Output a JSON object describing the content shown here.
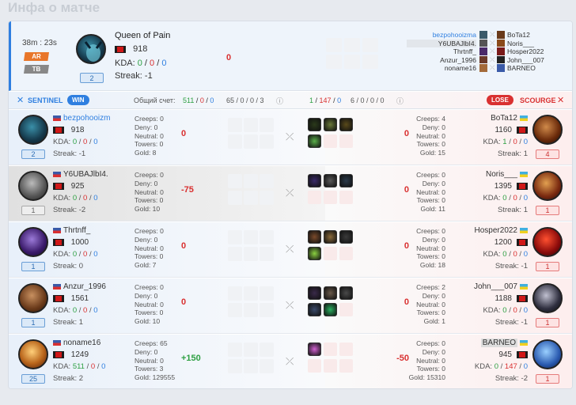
{
  "page_title": "Инфа о матче",
  "summary": {
    "duration": "38m : 23s",
    "mode1": "AR",
    "mode2": "TB",
    "hero_name": "Queen of Pain",
    "hero_level": "2",
    "rating": "918",
    "kda_label": "KDA:",
    "kills": "0",
    "deaths": "0",
    "assists": "0",
    "streak": "Streak: -1",
    "rating_delta": "0",
    "sentinel_players": [
      "bezpohooizma",
      "Y6UBAJlbI4.",
      "Thrtnff_",
      "Anzur_1996",
      "noname16"
    ],
    "scourge_players": [
      "BoTa12",
      "Noris___",
      "Hosper2022",
      "John___007",
      "BARNEO"
    ]
  },
  "teambar": {
    "sentinel": "SENTINEL",
    "win": "WIN",
    "total_label": "Общий счет:",
    "s_k": "511",
    "s_d": "0",
    "s_a": "0",
    "s_extra": "65 / 0 / 0 / 3",
    "c_k": "1",
    "c_d": "147",
    "c_a": "0",
    "c_extra": "6 / 0 / 0 / 0",
    "lose": "LOSE",
    "scourge": "SCOURGE"
  },
  "rows": [
    {
      "name": "bezpohooizm",
      "rating": "918",
      "k": "0",
      "d": "0",
      "a": "0",
      "streak": "Streak: -1",
      "level": "2",
      "creeps": "Creeps: 0",
      "deny": "Deny: 0",
      "neutral": "Neutral: 0",
      "towers": "Towers: 0",
      "gold": "Gold: 8",
      "delta": "0",
      "r_creeps": "Creeps: 4",
      "r_deny": "Deny: 0",
      "r_neutral": "Neutral: 0",
      "r_towers": "Towers: 0",
      "r_gold": "Gold: 15",
      "r_delta": "0",
      "r_name": "BoTa12",
      "r_rating": "1160",
      "r_k": "1",
      "r_d": "0",
      "r_a": "0",
      "r_streak": "Streak: 1",
      "r_level": "4"
    },
    {
      "name": "Y6UBAJlbI4.",
      "rating": "925",
      "k": "0",
      "d": "0",
      "a": "0",
      "streak": "Streak: -2",
      "level": "1",
      "creeps": "Creeps: 0",
      "deny": "Deny: 0",
      "neutral": "Neutral: 0",
      "towers": "Towers: 0",
      "gold": "Gold: 10",
      "delta": "-75",
      "r_creeps": "Creeps: 0",
      "r_deny": "Deny: 0",
      "r_neutral": "Neutral: 0",
      "r_towers": "Towers: 0",
      "r_gold": "Gold: 11",
      "r_delta": "0",
      "r_name": "Noris___",
      "r_rating": "1395",
      "r_k": "0",
      "r_d": "0",
      "r_a": "0",
      "r_streak": "Streak: 1",
      "r_level": "1"
    },
    {
      "name": "Thrtnff_",
      "rating": "1000",
      "k": "0",
      "d": "0",
      "a": "0",
      "streak": "Streak: 0",
      "level": "1",
      "creeps": "Creeps: 0",
      "deny": "Deny: 0",
      "neutral": "Neutral: 0",
      "towers": "Towers: 0",
      "gold": "Gold: 7",
      "delta": "0",
      "r_creeps": "Creeps: 0",
      "r_deny": "Deny: 0",
      "r_neutral": "Neutral: 0",
      "r_towers": "Towers: 0",
      "r_gold": "Gold: 18",
      "r_delta": "0",
      "r_name": "Hosper2022",
      "r_rating": "1200",
      "r_k": "0",
      "r_d": "0",
      "r_a": "0",
      "r_streak": "Streak: -1",
      "r_level": "1"
    },
    {
      "name": "Anzur_1996",
      "rating": "1561",
      "k": "0",
      "d": "0",
      "a": "0",
      "streak": "Streak: 1",
      "level": "1",
      "creeps": "Creeps: 0",
      "deny": "Deny: 0",
      "neutral": "Neutral: 0",
      "towers": "Towers: 0",
      "gold": "Gold: 10",
      "delta": "0",
      "r_creeps": "Creeps: 2",
      "r_deny": "Deny: 0",
      "r_neutral": "Neutral: 0",
      "r_towers": "Towers: 0",
      "r_gold": "Gold: 1",
      "r_delta": "0",
      "r_name": "John___007",
      "r_rating": "1188",
      "r_k": "0",
      "r_d": "0",
      "r_a": "0",
      "r_streak": "Streak: -1",
      "r_level": "1"
    },
    {
      "name": "noname16",
      "rating": "1249",
      "k": "511",
      "d": "0",
      "a": "0",
      "streak": "Streak: 2",
      "level": "25",
      "creeps": "Creeps: 65",
      "deny": "Deny: 0",
      "neutral": "Neutral: 0",
      "towers": "Towers: 3",
      "gold": "Gold: 129555",
      "delta": "+150",
      "r_creeps": "Creeps: 0",
      "r_deny": "Deny: 0",
      "r_neutral": "Neutral: 0",
      "r_towers": "Towers: 0",
      "r_gold": "Gold: 15310",
      "r_delta": "-50",
      "r_name": "BARNEO",
      "r_rating": "945",
      "r_k": "0",
      "r_d": "147",
      "r_a": "0",
      "r_streak": "Streak: -2",
      "r_level": "1"
    }
  ],
  "colors": {
    "sentinel": "#2f7fe0",
    "scourge": "#d93030",
    "win": "#2f7fe0",
    "lose": "#d93030",
    "positive": "#2ea043",
    "negative": "#d93030"
  }
}
